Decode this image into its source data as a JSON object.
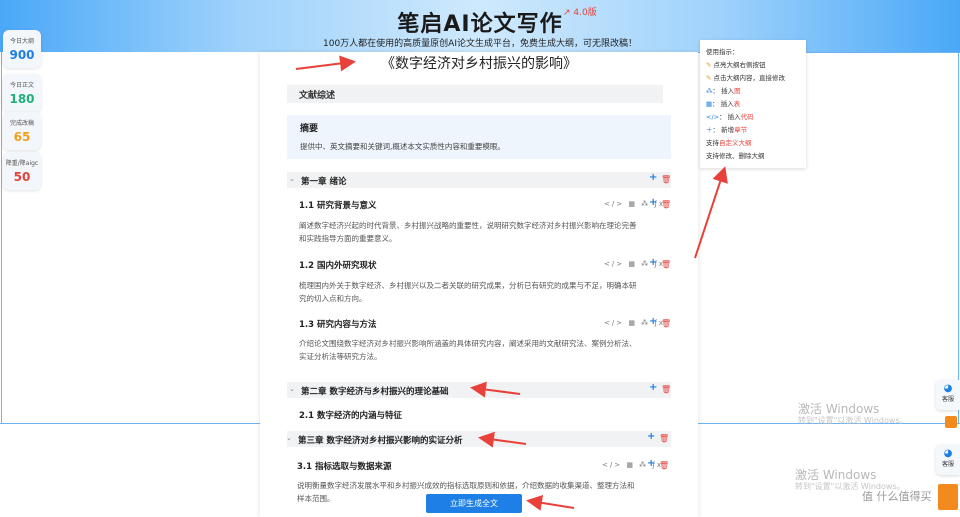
{
  "header": {
    "title": "笔启AI论文写作",
    "version": "4.0版",
    "subtitle": "100万人都在使用的高质量原创AI论文生成平台，免费生成大纲，可无限改稿！"
  },
  "stats": [
    {
      "label": "今日大纲",
      "value": "900",
      "color": "#1e7fe6"
    },
    {
      "label": "今日正文",
      "value": "180",
      "color": "#22b07a"
    },
    {
      "label": "完成改稿",
      "value": "65",
      "color": "#f0a020"
    },
    {
      "label": "降重/降aigc",
      "value": "50",
      "color": "#e8413a"
    }
  ],
  "paper": {
    "title": "《数字经济对乡村振兴的影响》",
    "literature_review": "文献综述",
    "abstract": {
      "title": "摘要",
      "description": "提供中、英文摘要和关键词,概述本文实质性内容和重要模眼。"
    },
    "chapters": [
      {
        "title": "第一章 绪论",
        "sections": [
          {
            "title": "1.1 研究背景与意义",
            "desc1": "阐述数字经济兴起的时代背景、乡村振兴战略的重要性，说明研究数字经济对乡村振兴影响在理论完善",
            "desc2": "和实践指导方面的重要意义。"
          },
          {
            "title": "1.2 国内外研究现状",
            "desc1": "梳理国内外关于数字经济、乡村振兴以及二者关联的研究成果，分析已有研究的成果与不足，明确本研",
            "desc2": "究的切入点和方向。"
          },
          {
            "title": "1.3 研究内容与方法",
            "desc1": "介绍论文围绕数字经济对乡村振兴影响所涵盖的具体研究内容，阐述采用的文献研究法、案例分析法、",
            "desc2": "实证分析法等研究方法。"
          }
        ]
      },
      {
        "title": "第二章 数字经济与乡村振兴的理论基础",
        "sections": [
          {
            "title": "2.1 数字经济的内涵与特征"
          }
        ]
      },
      {
        "title": "第三章 数字经济对乡村振兴影响的实证分析",
        "sections": [
          {
            "title": "3.1 指标选取与数据来源",
            "desc1": "说明衡量数字经济发展水平和乡村振兴成效的指标选取原则和依据，介绍数据的收集渠道、整理方法和",
            "desc2": "样本范围。"
          }
        ]
      }
    ],
    "section_icons": "</> ▦ ⁂ ƒx"
  },
  "help": {
    "title": "使用指示：",
    "lines": [
      {
        "pre": "",
        "text": "点亮大纲右侧按钮"
      },
      {
        "pre": "",
        "text": "点击大纲内容，直接修改"
      },
      {
        "pre": "插入",
        "text": "图"
      },
      {
        "pre": "插入",
        "text": "表"
      },
      {
        "pre": "插入",
        "text": "代码"
      },
      {
        "pre": "新增",
        "text": "章节"
      },
      {
        "pre": "支持",
        "text": "自定义大纲"
      },
      {
        "pre": "",
        "text": "支持修改、删除大纲"
      }
    ]
  },
  "generate_button": "立即生成全文",
  "side_widgets": [
    {
      "label": "客服"
    },
    {
      "label": "客服"
    }
  ],
  "watermark": {
    "line1": "激活 Windows",
    "line2": "转到\"设置\"以激活 Windows。"
  },
  "corner_text": "值 什么值得买"
}
